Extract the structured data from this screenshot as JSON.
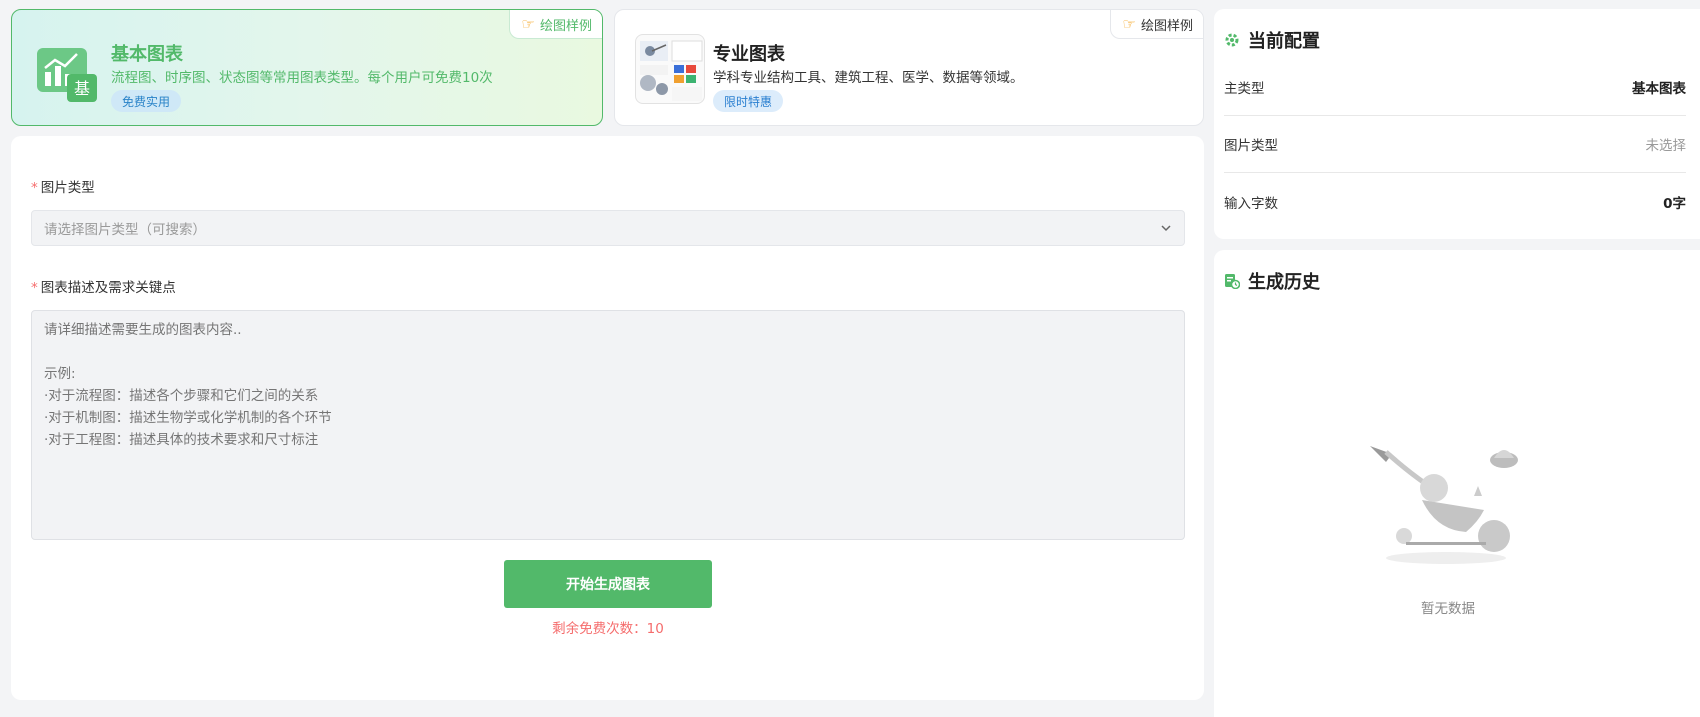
{
  "cards": {
    "basic": {
      "title": "基本图表",
      "desc": "流程图、时序图、状态图等常用图表类型。每个用户可免费10次",
      "pill": "免费实用",
      "sample": "绘图样例",
      "icon_char": "基"
    },
    "pro": {
      "title": "专业图表",
      "desc": "学科专业结构工具、建筑工程、医学、数据等领域。",
      "pill": "限时特惠",
      "sample": "绘图样例"
    }
  },
  "form": {
    "type_label": "图片类型",
    "type_placeholder": "请选择图片类型（可搜索）",
    "desc_label": "图表描述及需求关键点",
    "desc_placeholder": "请详细描述需要生成的图表内容..\n\n示例:\n·对于流程图：描述各个步骤和它们之间的关系\n·对于机制图：描述生物学或化学机制的各个环节\n·对于工程图：描述具体的技术要求和尺寸标注",
    "required_mark": "*",
    "generate_label": "开始生成图表",
    "remaining_text": "剩余免费次数：10"
  },
  "config": {
    "title": "当前配置",
    "rows": [
      {
        "label": "主类型",
        "value": "基本图表"
      },
      {
        "label": "图片类型",
        "value": "未选择"
      },
      {
        "label": "输入字数",
        "value": "0字"
      }
    ]
  },
  "history": {
    "title": "生成历史",
    "empty_text": "暂无数据"
  },
  "colors": {
    "accent": "#52b96a",
    "danger": "#f56c6c",
    "pill_blue": "#2a83c8"
  },
  "icons": {
    "sample": "pointing-hand-icon",
    "select": "chevron-down-icon",
    "config": "settings-gear-icon",
    "history": "history-document-icon"
  }
}
